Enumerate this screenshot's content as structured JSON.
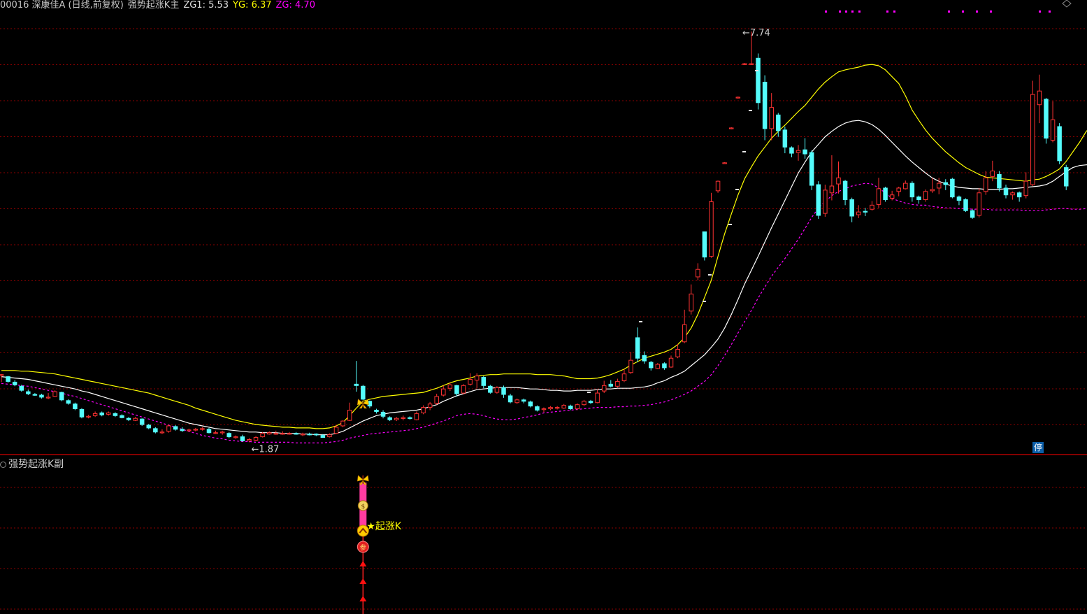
{
  "header": {
    "stock": "00016 深康佳A (日线,前复权)",
    "indicator": "强势起涨K主",
    "zg1": "ZG1: 5.53",
    "yg": "YG: 6.37",
    "zg": "ZG: 4.70"
  },
  "sub_panel": {
    "title": "强势起涨K副",
    "signal_label": "起涨K"
  },
  "stop_badge": "停",
  "colors": {
    "background": "#000000",
    "up_candle": "#ff3232",
    "down_candle": "#54fcfc",
    "yg_line": "#ffff00",
    "zg1_line": "#ffffff",
    "zg_line": "#ff00ff",
    "grid": "#8b0000"
  },
  "chart_data": {
    "type": "candlestick",
    "series_names": [
      "YG",
      "ZG1",
      "ZG"
    ],
    "annotations": {
      "high_label": "7.74",
      "low_label": "1.87",
      "high_value": 7.74,
      "low_value": 1.87
    },
    "candles": [
      [
        2.71,
        2.72,
        2.73,
        2.61
      ],
      [
        2.69,
        2.62,
        2.7,
        2.6
      ],
      [
        2.61,
        2.57,
        2.64,
        2.55
      ],
      [
        2.55,
        2.49,
        2.57,
        2.47
      ],
      [
        2.47,
        2.44,
        2.5,
        2.42
      ],
      [
        2.43,
        2.42,
        2.45,
        2.41
      ],
      [
        2.42,
        2.39,
        2.44,
        2.37
      ],
      [
        2.38,
        2.39,
        2.45,
        2.36
      ],
      [
        2.4,
        2.47,
        2.49,
        2.39
      ],
      [
        2.46,
        2.35,
        2.47,
        2.33
      ],
      [
        2.34,
        2.3,
        2.36,
        2.28
      ],
      [
        2.29,
        2.22,
        2.31,
        2.2
      ],
      [
        2.21,
        2.1,
        2.23,
        2.08
      ],
      [
        2.1,
        2.11,
        2.13,
        2.08
      ],
      [
        2.12,
        2.15,
        2.18,
        2.1
      ],
      [
        2.16,
        2.13,
        2.18,
        2.11
      ],
      [
        2.14,
        2.16,
        2.18,
        2.12
      ],
      [
        2.15,
        2.12,
        2.17,
        2.1
      ],
      [
        2.12,
        2.09,
        2.14,
        2.08
      ],
      [
        2.08,
        2.06,
        2.1,
        2.04
      ],
      [
        2.05,
        2.08,
        2.1,
        2.04
      ],
      [
        2.07,
        1.99,
        2.08,
        1.97
      ],
      [
        1.98,
        1.94,
        2.0,
        1.92
      ],
      [
        1.93,
        1.88,
        1.95,
        1.86
      ],
      [
        1.88,
        1.88,
        1.92,
        1.85
      ],
      [
        1.89,
        1.97,
        1.99,
        1.87
      ],
      [
        1.96,
        1.92,
        1.98,
        1.9
      ],
      [
        1.92,
        1.9,
        1.95,
        1.88
      ],
      [
        1.9,
        1.91,
        1.93,
        1.88
      ],
      [
        1.91,
        1.92,
        1.94,
        1.89
      ],
      [
        1.92,
        1.93,
        1.95,
        1.9
      ],
      [
        1.92,
        1.87,
        1.94,
        1.86
      ],
      [
        1.86,
        1.87,
        1.9,
        1.85
      ],
      [
        1.87,
        1.88,
        1.9,
        1.84
      ],
      [
        1.86,
        1.81,
        1.88,
        1.79
      ],
      [
        1.8,
        1.81,
        1.83,
        1.78
      ],
      [
        1.81,
        1.75,
        1.84,
        1.74
      ],
      [
        1.75,
        1.77,
        1.79,
        1.73
      ],
      [
        1.76,
        1.8,
        1.82,
        1.75
      ],
      [
        1.81,
        1.86,
        1.88,
        1.8
      ],
      [
        1.85,
        1.87,
        1.89,
        1.84
      ],
      [
        1.86,
        1.86,
        1.9,
        1.84
      ],
      [
        1.86,
        1.86,
        1.89,
        1.84
      ],
      [
        1.85,
        1.86,
        1.88,
        1.84
      ],
      [
        1.86,
        1.85,
        1.88,
        1.84
      ],
      [
        1.84,
        1.85,
        1.87,
        1.82
      ],
      [
        1.85,
        1.84,
        1.87,
        1.83
      ],
      [
        1.85,
        1.84,
        1.86,
        1.82
      ],
      [
        1.83,
        1.8,
        1.85,
        1.8
      ],
      [
        1.81,
        1.84,
        1.86,
        1.8
      ],
      [
        1.86,
        1.95,
        1.98,
        1.85
      ],
      [
        1.97,
        2.04,
        2.05,
        1.95
      ],
      [
        2.05,
        2.2,
        2.31,
        2.04
      ],
      [
        2.58,
        2.56,
        2.92,
        2.47
      ],
      [
        2.55,
        2.36,
        2.57,
        2.32
      ],
      [
        2.33,
        2.26,
        2.34,
        2.23
      ],
      [
        2.2,
        2.18,
        2.22,
        2.15
      ],
      [
        2.17,
        2.11,
        2.2,
        2.08
      ],
      [
        2.09,
        2.06,
        2.11,
        2.04
      ],
      [
        2.06,
        2.08,
        2.1,
        2.04
      ],
      [
        2.08,
        2.09,
        2.12,
        2.05
      ],
      [
        2.09,
        2.08,
        2.11,
        2.06
      ],
      [
        2.06,
        2.15,
        2.18,
        2.05
      ],
      [
        2.16,
        2.24,
        2.27,
        2.14
      ],
      [
        2.24,
        2.29,
        2.32,
        2.2
      ],
      [
        2.3,
        2.4,
        2.44,
        2.28
      ],
      [
        2.42,
        2.51,
        2.56,
        2.4
      ],
      [
        2.52,
        2.57,
        2.6,
        2.48
      ],
      [
        2.56,
        2.44,
        2.57,
        2.4
      ],
      [
        2.45,
        2.56,
        2.58,
        2.43
      ],
      [
        2.58,
        2.65,
        2.74,
        2.56
      ],
      [
        2.64,
        2.7,
        2.74,
        2.52
      ],
      [
        2.68,
        2.56,
        2.7,
        2.52
      ],
      [
        2.55,
        2.46,
        2.57,
        2.44
      ],
      [
        2.46,
        2.53,
        2.55,
        2.44
      ],
      [
        2.53,
        2.43,
        2.56,
        2.38
      ],
      [
        2.41,
        2.32,
        2.44,
        2.3
      ],
      [
        2.31,
        2.35,
        2.37,
        2.29
      ],
      [
        2.35,
        2.33,
        2.37,
        2.3
      ],
      [
        2.32,
        2.26,
        2.34,
        2.24
      ],
      [
        2.25,
        2.2,
        2.27,
        2.18
      ],
      [
        2.21,
        2.22,
        2.24,
        2.17
      ],
      [
        2.22,
        2.24,
        2.26,
        2.2
      ],
      [
        2.23,
        2.24,
        2.26,
        2.21
      ],
      [
        2.23,
        2.27,
        2.29,
        2.22
      ],
      [
        2.26,
        2.22,
        2.28,
        2.2
      ],
      [
        2.22,
        2.28,
        2.3,
        2.2
      ],
      [
        2.28,
        2.33,
        2.35,
        2.26
      ],
      [
        2.33,
        2.31,
        2.35,
        2.29
      ],
      [
        2.31,
        2.45,
        2.5,
        2.3
      ],
      [
        2.48,
        2.56,
        2.63,
        2.45
      ],
      [
        2.58,
        2.55,
        2.64,
        2.53
      ],
      [
        2.55,
        2.62,
        2.66,
        2.53
      ],
      [
        2.63,
        2.73,
        2.8,
        2.61
      ],
      [
        2.75,
        2.93,
        3.05,
        2.73
      ],
      [
        3.26,
        2.96,
        3.41,
        2.9
      ],
      [
        3.0,
        2.92,
        3.06,
        2.88
      ],
      [
        2.9,
        2.82,
        2.92,
        2.78
      ],
      [
        2.81,
        2.87,
        2.89,
        2.8
      ],
      [
        2.88,
        2.82,
        2.9,
        2.79
      ],
      [
        2.83,
        2.96,
        3.0,
        2.82
      ],
      [
        2.98,
        3.09,
        3.17,
        2.96
      ],
      [
        3.2,
        3.45,
        3.67,
        3.18
      ],
      [
        3.65,
        3.9,
        4.04,
        3.6
      ],
      [
        4.15,
        4.26,
        4.35,
        4.1
      ],
      [
        4.81,
        4.44,
        4.81,
        4.39
      ],
      [
        4.45,
        5.25,
        5.38,
        4.43
      ],
      [
        5.41,
        5.55,
        5.56,
        5.38
      ],
      [
        5.82,
        5.82,
        5.83,
        5.81
      ],
      [
        6.32,
        6.33,
        6.34,
        6.31
      ],
      [
        6.77,
        6.78,
        6.79,
        6.76
      ],
      [
        7.26,
        7.27,
        7.28,
        7.25
      ],
      [
        7.26,
        7.27,
        7.74,
        7.25
      ],
      [
        7.35,
        6.7,
        7.42,
        6.6
      ],
      [
        7.0,
        6.32,
        7.1,
        6.15
      ],
      [
        6.32,
        6.63,
        6.84,
        6.15
      ],
      [
        6.52,
        6.29,
        6.55,
        6.2
      ],
      [
        6.3,
        6.05,
        6.35,
        5.96
      ],
      [
        6.04,
        5.96,
        6.06,
        5.9
      ],
      [
        5.97,
        6.0,
        6.08,
        5.85
      ],
      [
        6.01,
        5.95,
        6.18,
        5.88
      ],
      [
        5.97,
        5.49,
        6.0,
        5.42
      ],
      [
        5.5,
        5.05,
        5.55,
        5.0
      ],
      [
        5.08,
        5.42,
        5.5,
        5.03
      ],
      [
        5.38,
        5.48,
        5.93,
        5.27
      ],
      [
        5.51,
        5.6,
        5.84,
        5.37
      ],
      [
        5.55,
        5.28,
        5.57,
        5.2
      ],
      [
        5.28,
        5.04,
        5.31,
        4.95
      ],
      [
        5.06,
        5.1,
        5.2,
        5.01
      ],
      [
        5.11,
        5.1,
        5.16,
        5.04
      ],
      [
        5.14,
        5.2,
        5.26,
        5.12
      ],
      [
        5.21,
        5.44,
        5.6,
        5.16
      ],
      [
        5.45,
        5.28,
        5.47,
        5.25
      ],
      [
        5.3,
        5.35,
        5.41,
        5.27
      ],
      [
        5.4,
        5.45,
        5.47,
        5.33
      ],
      [
        5.44,
        5.52,
        5.56,
        5.43
      ],
      [
        5.52,
        5.32,
        5.55,
        5.25
      ],
      [
        5.32,
        5.28,
        5.34,
        5.22
      ],
      [
        5.28,
        5.4,
        5.43,
        5.25
      ],
      [
        5.41,
        5.43,
        5.6,
        5.38
      ],
      [
        5.45,
        5.52,
        5.6,
        5.36
      ],
      [
        5.53,
        5.5,
        5.58,
        5.42
      ],
      [
        5.58,
        5.32,
        5.6,
        5.3
      ],
      [
        5.32,
        5.27,
        5.34,
        5.2
      ],
      [
        5.28,
        5.12,
        5.3,
        5.1
      ],
      [
        5.12,
        5.02,
        5.14,
        5.0
      ],
      [
        5.05,
        5.38,
        5.45,
        5.02
      ],
      [
        5.4,
        5.6,
        5.7,
        5.35
      ],
      [
        5.62,
        5.7,
        5.85,
        5.55
      ],
      [
        5.65,
        5.45,
        5.7,
        5.4
      ],
      [
        5.45,
        5.35,
        5.5,
        5.3
      ],
      [
        5.35,
        5.38,
        5.4,
        5.28
      ],
      [
        5.38,
        5.32,
        5.4,
        5.25
      ],
      [
        5.34,
        5.55,
        5.68,
        5.3
      ],
      [
        5.5,
        6.82,
        7.02,
        5.48
      ],
      [
        6.67,
        6.87,
        7.11,
        6.4
      ],
      [
        6.75,
        6.18,
        6.77,
        6.1
      ],
      [
        6.15,
        6.45,
        6.72,
        6.12
      ],
      [
        6.35,
        5.85,
        6.4,
        5.8
      ],
      [
        5.75,
        5.48,
        5.79,
        5.42
      ]
    ],
    "yg": [
      2.78,
      2.78,
      2.78,
      2.77,
      2.77,
      2.76,
      2.75,
      2.74,
      2.73,
      2.71,
      2.69,
      2.67,
      2.65,
      2.63,
      2.61,
      2.59,
      2.57,
      2.55,
      2.53,
      2.51,
      2.49,
      2.47,
      2.45,
      2.42,
      2.39,
      2.36,
      2.33,
      2.3,
      2.27,
      2.23,
      2.2,
      2.17,
      2.14,
      2.11,
      2.08,
      2.05,
      2.03,
      2.01,
      1.99,
      1.98,
      1.97,
      1.96,
      1.95,
      1.95,
      1.94,
      1.94,
      1.94,
      1.93,
      1.93,
      1.94,
      1.97,
      2.02,
      2.12,
      2.23,
      2.33,
      2.36,
      2.38,
      2.4,
      2.41,
      2.42,
      2.43,
      2.44,
      2.45,
      2.46,
      2.49,
      2.52,
      2.56,
      2.6,
      2.63,
      2.65,
      2.67,
      2.7,
      2.71,
      2.72,
      2.72,
      2.73,
      2.73,
      2.73,
      2.73,
      2.73,
      2.72,
      2.72,
      2.72,
      2.71,
      2.7,
      2.68,
      2.66,
      2.66,
      2.66,
      2.67,
      2.69,
      2.72,
      2.76,
      2.8,
      2.86,
      2.91,
      2.96,
      2.99,
      3.02,
      3.05,
      3.09,
      3.16,
      3.26,
      3.4,
      3.6,
      3.85,
      4.1,
      4.45,
      4.78,
      5.07,
      5.35,
      5.59,
      5.76,
      5.92,
      6.05,
      6.18,
      6.28,
      6.37,
      6.47,
      6.57,
      6.66,
      6.78,
      6.9,
      7.0,
      7.08,
      7.15,
      7.18,
      7.2,
      7.22,
      7.25,
      7.26,
      7.24,
      7.18,
      7.08,
      6.98,
      6.8,
      6.59,
      6.44,
      6.3,
      6.18,
      6.08,
      5.98,
      5.9,
      5.82,
      5.75,
      5.7,
      5.65,
      5.61,
      5.6,
      5.59,
      5.58,
      5.57,
      5.56,
      5.55,
      5.57,
      5.58,
      5.62,
      5.67,
      5.73,
      5.84,
      5.98,
      6.12,
      6.28,
      6.37,
      6.37
    ],
    "zg1": [
      2.69,
      2.68,
      2.67,
      2.66,
      2.65,
      2.63,
      2.61,
      2.59,
      2.57,
      2.55,
      2.53,
      2.51,
      2.48,
      2.46,
      2.43,
      2.4,
      2.37,
      2.34,
      2.31,
      2.28,
      2.25,
      2.22,
      2.19,
      2.16,
      2.13,
      2.1,
      2.07,
      2.04,
      2.01,
      1.99,
      1.97,
      1.95,
      1.93,
      1.92,
      1.91,
      1.9,
      1.89,
      1.88,
      1.88,
      1.87,
      1.87,
      1.87,
      1.86,
      1.86,
      1.86,
      1.85,
      1.85,
      1.84,
      1.84,
      1.84,
      1.86,
      1.89,
      1.94,
      1.99,
      2.04,
      2.08,
      2.12,
      2.14,
      2.16,
      2.17,
      2.18,
      2.19,
      2.2,
      2.22,
      2.25,
      2.28,
      2.33,
      2.37,
      2.41,
      2.44,
      2.47,
      2.5,
      2.51,
      2.52,
      2.53,
      2.53,
      2.53,
      2.53,
      2.52,
      2.51,
      2.51,
      2.5,
      2.49,
      2.49,
      2.48,
      2.48,
      2.49,
      2.49,
      2.49,
      2.5,
      2.51,
      2.51,
      2.52,
      2.52,
      2.52,
      2.53,
      2.54,
      2.56,
      2.6,
      2.63,
      2.68,
      2.72,
      2.77,
      2.85,
      2.93,
      3.01,
      3.12,
      3.24,
      3.4,
      3.6,
      3.82,
      4.05,
      4.25,
      4.45,
      4.66,
      4.87,
      5.07,
      5.27,
      5.47,
      5.67,
      5.83,
      5.98,
      6.09,
      6.2,
      6.28,
      6.35,
      6.4,
      6.43,
      6.44,
      6.42,
      6.38,
      6.31,
      6.22,
      6.12,
      6.02,
      5.92,
      5.83,
      5.75,
      5.67,
      5.6,
      5.55,
      5.51,
      5.48,
      5.46,
      5.45,
      5.44,
      5.44,
      5.43,
      5.43,
      5.43,
      5.44,
      5.44,
      5.45,
      5.46,
      5.47,
      5.48,
      5.5,
      5.55,
      5.62,
      5.69,
      5.75,
      5.78,
      5.79,
      5.8,
      5.81
    ],
    "zg": [
      2.59,
      2.58,
      2.57,
      2.56,
      2.55,
      2.53,
      2.51,
      2.49,
      2.47,
      2.45,
      2.42,
      2.4,
      2.37,
      2.34,
      2.31,
      2.28,
      2.25,
      2.22,
      2.19,
      2.16,
      2.13,
      2.1,
      2.07,
      2.04,
      2.01,
      1.98,
      1.95,
      1.92,
      1.89,
      1.86,
      1.83,
      1.81,
      1.79,
      1.78,
      1.76,
      1.75,
      1.74,
      1.74,
      1.73,
      1.73,
      1.73,
      1.73,
      1.73,
      1.73,
      1.72,
      1.72,
      1.72,
      1.72,
      1.72,
      1.73,
      1.74,
      1.76,
      1.79,
      1.81,
      1.83,
      1.85,
      1.86,
      1.87,
      1.88,
      1.89,
      1.9,
      1.91,
      1.93,
      1.95,
      1.98,
      2.01,
      2.04,
      2.08,
      2.12,
      2.14,
      2.15,
      2.14,
      2.12,
      2.09,
      2.07,
      2.06,
      2.06,
      2.07,
      2.09,
      2.11,
      2.13,
      2.16,
      2.17,
      2.18,
      2.19,
      2.2,
      2.21,
      2.22,
      2.23,
      2.24,
      2.24,
      2.24,
      2.25,
      2.25,
      2.26,
      2.26,
      2.27,
      2.28,
      2.3,
      2.32,
      2.35,
      2.39,
      2.43,
      2.48,
      2.55,
      2.62,
      2.72,
      2.85,
      3.0,
      3.16,
      3.33,
      3.5,
      3.66,
      3.84,
      4.0,
      4.16,
      4.29,
      4.42,
      4.56,
      4.7,
      4.86,
      5.02,
      5.16,
      5.25,
      5.34,
      5.4,
      5.44,
      5.48,
      5.5,
      5.52,
      5.51,
      5.45,
      5.38,
      5.3,
      5.26,
      5.23,
      5.21,
      5.2,
      5.2,
      5.18,
      5.17,
      5.16,
      5.16,
      5.15,
      5.15,
      5.14,
      5.14,
      5.14,
      5.13,
      5.13,
      5.13,
      5.13,
      5.13,
      5.12,
      5.12,
      5.12,
      5.13,
      5.14,
      5.15,
      5.15,
      5.14,
      5.14,
      5.15,
      5.15
    ],
    "ylim": [
      1.55,
      8.1
    ],
    "sub_signal": {
      "bar_index": 54
    }
  }
}
